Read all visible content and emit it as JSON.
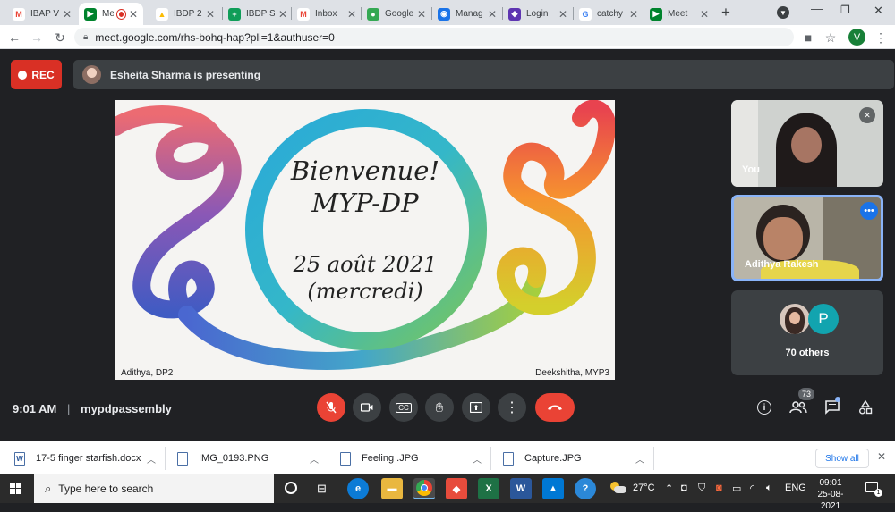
{
  "browser": {
    "tabs": [
      {
        "label": "IBAP V",
        "color": "#ea4335",
        "letter": "M"
      },
      {
        "label": "Me",
        "color": "#00832d",
        "letter": "▶"
      },
      {
        "label": "IBDP 2",
        "color": "#fbbc04",
        "letter": "▲"
      },
      {
        "label": "IBDP S",
        "color": "#0f9d58",
        "letter": "+"
      },
      {
        "label": "Inbox",
        "color": "#ea4335",
        "letter": "M"
      },
      {
        "label": "Google",
        "color": "#34a853",
        "letter": "●"
      },
      {
        "label": "Manag",
        "color": "#1a73e8",
        "letter": "◉"
      },
      {
        "label": "Login",
        "color": "#5e35b1",
        "letter": "◆"
      },
      {
        "label": "catchy",
        "color": "#4285f4",
        "letter": "G"
      },
      {
        "label": "Meet",
        "color": "#00832d",
        "letter": "▶"
      }
    ],
    "url": "meet.google.com/rhs-bohq-hap?pli=1&authuser=0",
    "profile_initial": "V"
  },
  "meet": {
    "rec_label": "REC",
    "presenter_banner": "Esheita Sharma is presenting",
    "slide": {
      "line1": "Bienvenue!",
      "line2": "MYP-DP",
      "line3": "25 août 2021",
      "line4": "(mercredi)",
      "left_label": "Adithya, DP2",
      "right_label": "Deekshitha, MYP3"
    },
    "tiles": {
      "you_label": "You",
      "adithya_label": "Adithya Rakesh",
      "others_initial": "P",
      "others_label": "70 others"
    },
    "time": "9:01 AM",
    "meeting_name": "mypdpassembly",
    "participant_count": "73"
  },
  "downloads": {
    "items": [
      {
        "name": "17-5 finger starfish.docx",
        "icon": "W"
      },
      {
        "name": "IMG_0193.PNG",
        "icon": ""
      },
      {
        "name": "Feeling .JPG",
        "icon": ""
      },
      {
        "name": "Capture.JPG",
        "icon": ""
      }
    ],
    "show_all": "Show all"
  },
  "taskbar": {
    "search_placeholder": "Type here to search",
    "weather": "27°C",
    "language": "ENG",
    "clock_time": "09:01",
    "clock_date": "25-08-2021"
  }
}
